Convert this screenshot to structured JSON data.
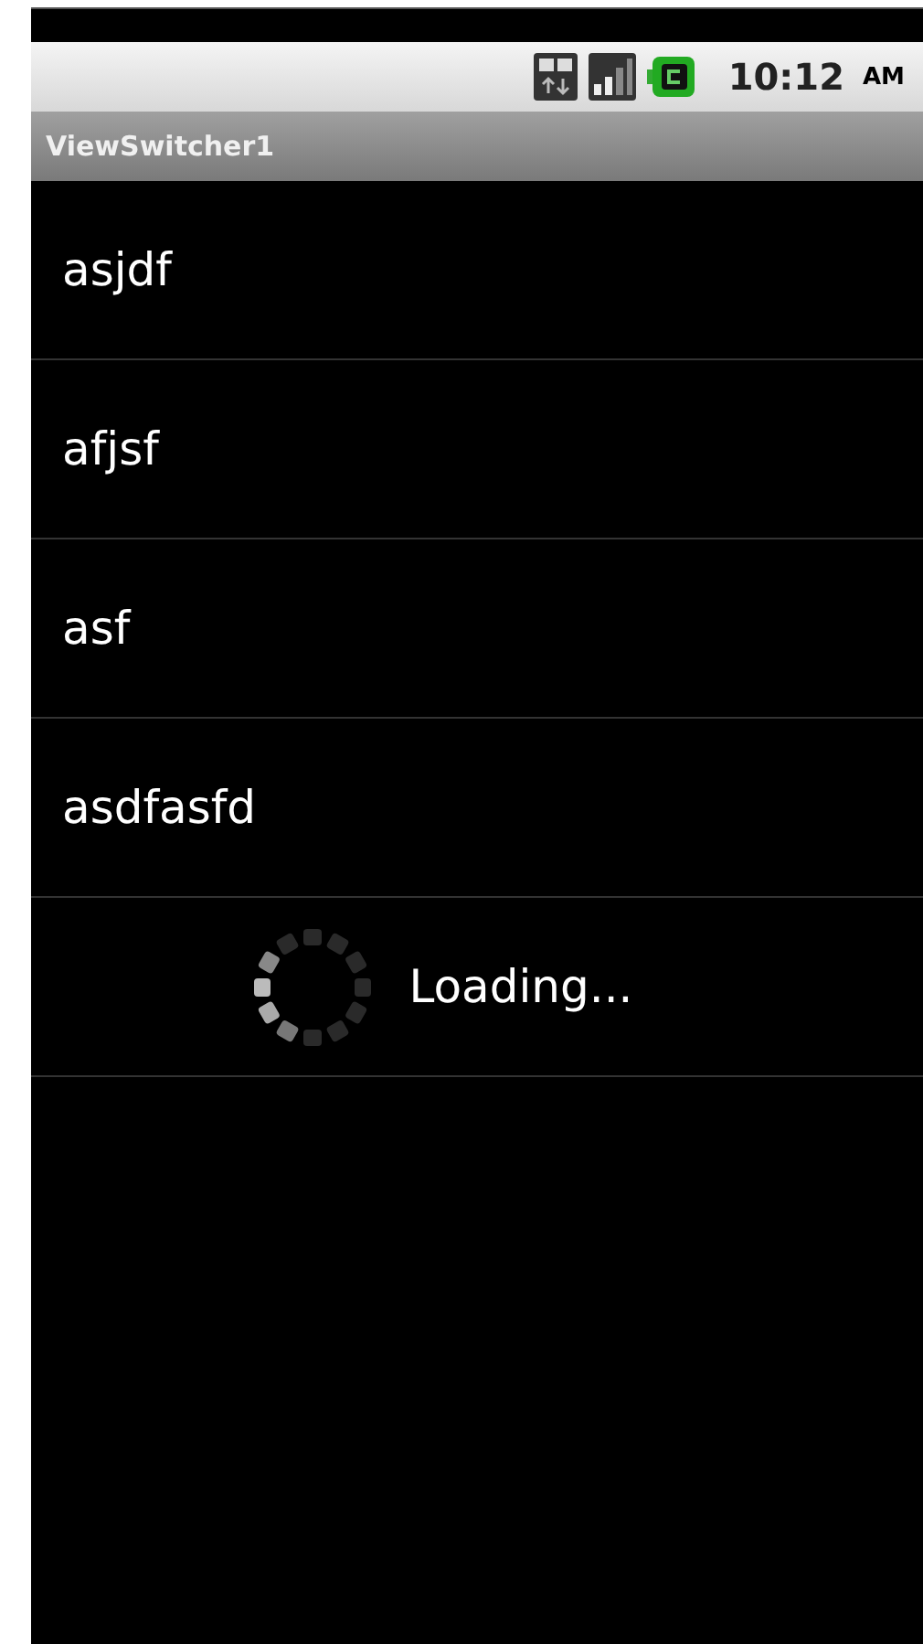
{
  "status_bar": {
    "time": "10:12",
    "am_pm": "AM"
  },
  "window": {
    "title": "ViewSwitcher1"
  },
  "list": {
    "items": [
      {
        "label": "asjdf"
      },
      {
        "label": "afjsf"
      },
      {
        "label": "asf"
      },
      {
        "label": "asdfasfd"
      }
    ],
    "footer": {
      "label": "Loading..."
    }
  }
}
